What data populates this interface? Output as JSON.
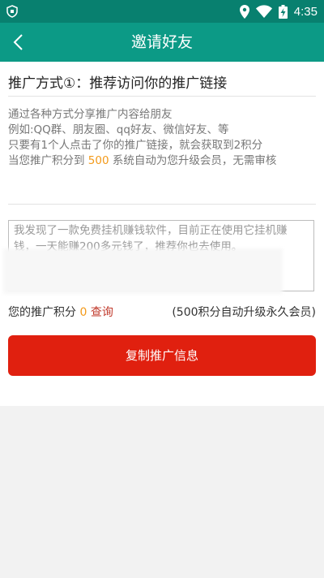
{
  "status_bar": {
    "time": "4:35",
    "icons": [
      "shield-icon",
      "location-icon",
      "wifi-icon",
      "battery-charging-icon"
    ]
  },
  "app_bar": {
    "title": "邀请好友",
    "back_icon": "back-arrow-icon"
  },
  "method": {
    "title": "推广方式①：推荐访问你的推广链接"
  },
  "description": {
    "line1": "通过各种方式分享推广内容给朋友",
    "line2": "例如:QQ群、朋友圈、qq好友、微信好友、等",
    "line3": "只要有1个人点击了你的推广链接，就会获取到2积分",
    "line4_prefix": "当您推广积分到 ",
    "line4_highlight": "500",
    "line4_suffix": " 系统自动为您升级会员，无需审核"
  },
  "message_box": {
    "text": "我发现了一款免费挂机赚钱软件，目前正在使用它挂机赚钱，一天能赚200多元钱了，推荐你也去使用。"
  },
  "points": {
    "label": "您的推广积分",
    "value": "0",
    "query_link": "查询",
    "upgrade_note": "(500积分自动升级永久会员)"
  },
  "copy_button": {
    "label": "复制推广信息"
  },
  "colors": {
    "status_bar": "#08806f",
    "app_bar": "#0c9a86",
    "button": "#e0200f",
    "highlight": "#f39a1a",
    "link": "#c0392b"
  }
}
